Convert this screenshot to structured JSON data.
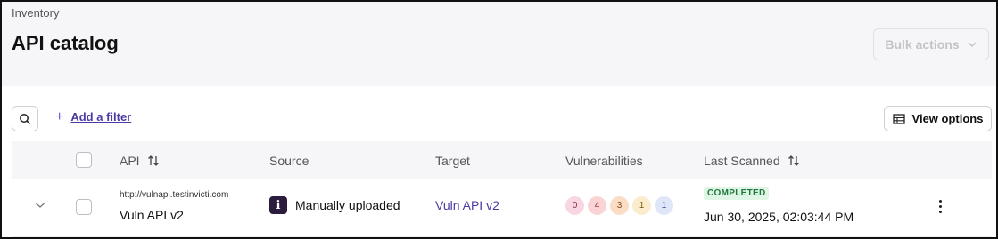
{
  "header": {
    "breadcrumb": "Inventory",
    "title": "API catalog",
    "bulk_actions_label": "Bulk actions"
  },
  "toolbar": {
    "add_filter_label": "Add a filter",
    "view_options_label": "View options"
  },
  "table": {
    "columns": [
      "API",
      "Source",
      "Target",
      "Vulnerabilities",
      "Last Scanned"
    ],
    "rows": [
      {
        "url": "http://vulnapi.testinvicti.com",
        "name": "Vuln API v2",
        "source_icon": "i",
        "source": "Manually uploaded",
        "target": "Vuln API v2",
        "vulnerabilities": [
          {
            "count": "0",
            "severity": "critical",
            "bg": "#f8d7e3",
            "fg": "#8a2846"
          },
          {
            "count": "4",
            "severity": "high",
            "bg": "#fad4d4",
            "fg": "#8a1f1f"
          },
          {
            "count": "3",
            "severity": "medium",
            "bg": "#fbdcc4",
            "fg": "#8a4a18"
          },
          {
            "count": "1",
            "severity": "low",
            "bg": "#fbeccc",
            "fg": "#7a5a10"
          },
          {
            "count": "1",
            "severity": "info",
            "bg": "#dfe6f8",
            "fg": "#2c4a8a"
          }
        ],
        "status": "COMPLETED",
        "last_scanned": "Jun 30, 2025, 02:03:44 PM"
      }
    ]
  },
  "colors": {
    "accent": "#4b3aa3",
    "status_completed": "#1e7a3c"
  }
}
